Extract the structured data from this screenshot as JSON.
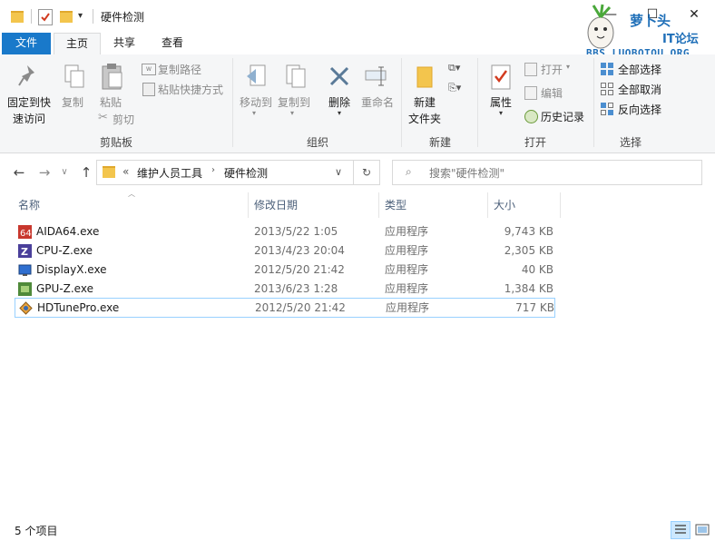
{
  "window": {
    "title": "硬件检测"
  },
  "tabs": {
    "file": "文件",
    "home": "主页",
    "share": "共享",
    "view": "查看"
  },
  "ribbon": {
    "clipboard": {
      "group": "剪贴板",
      "pin_line1": "固定到快",
      "pin_line2": "速访问",
      "copy": "复制",
      "paste": "粘贴",
      "copy_path": "复制路径",
      "paste_shortcut": "粘贴快捷方式",
      "cut": "剪切"
    },
    "organize": {
      "group": "组织",
      "move_to": "移动到",
      "copy_to": "复制到",
      "delete": "删除",
      "rename": "重命名"
    },
    "new": {
      "group": "新建",
      "new_folder_line1": "新建",
      "new_folder_line2": "文件夹"
    },
    "open": {
      "group": "打开",
      "properties": "属性",
      "open": "打开",
      "edit": "编辑",
      "history": "历史记录"
    },
    "select": {
      "group": "选择",
      "select_all": "全部选择",
      "select_none": "全部取消",
      "invert": "反向选择"
    }
  },
  "address": {
    "overflow": "«",
    "crumb1": "维护人员工具",
    "crumb2": "硬件检测",
    "search_placeholder": "搜索\"硬件检测\""
  },
  "columns": {
    "name": "名称",
    "date": "修改日期",
    "type": "类型",
    "size": "大小"
  },
  "files": [
    {
      "name": "AIDA64.exe",
      "date": "2013/5/22 1:05",
      "type": "应用程序",
      "size": "9,743 KB",
      "icon": "aida64-icon"
    },
    {
      "name": "CPU-Z.exe",
      "date": "2013/4/23 20:04",
      "type": "应用程序",
      "size": "2,305 KB",
      "icon": "cpuz-icon"
    },
    {
      "name": "DisplayX.exe",
      "date": "2012/5/20 21:42",
      "type": "应用程序",
      "size": "40 KB",
      "icon": "displayx-icon"
    },
    {
      "name": "GPU-Z.exe",
      "date": "2013/6/23 1:28",
      "type": "应用程序",
      "size": "1,384 KB",
      "icon": "gpuz-icon"
    },
    {
      "name": "HDTunePro.exe",
      "date": "2012/5/20 21:42",
      "type": "应用程序",
      "size": "717 KB",
      "icon": "hdtune-icon"
    }
  ],
  "status": {
    "count": "5 个项目"
  },
  "watermark": {
    "line1": "萝卜头",
    "line2": "IT论坛",
    "line3": "BBS.LUOBOTOU.ORG"
  }
}
